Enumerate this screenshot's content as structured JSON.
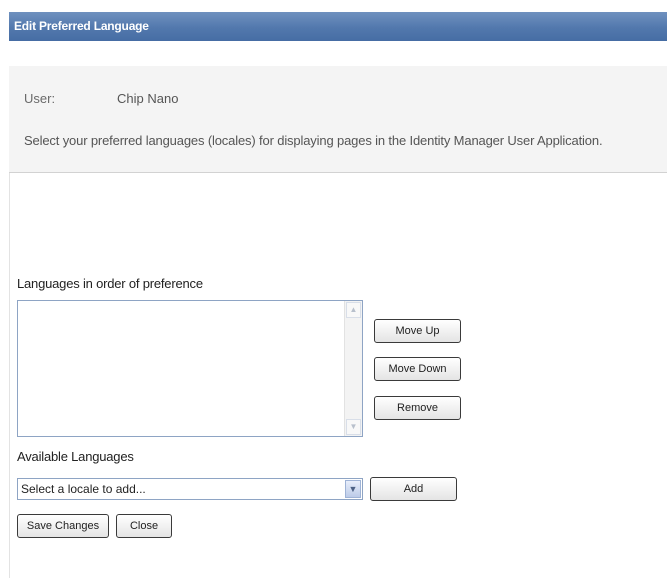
{
  "window": {
    "title": "Edit Preferred Language"
  },
  "info": {
    "user_label": "User:",
    "user_value": "Chip Nano",
    "description": "Select your preferred languages (locales) for displaying pages in the Identity Manager User Application."
  },
  "preferences": {
    "heading": "Languages in order of preference",
    "items": [],
    "move_up_label": "Move Up",
    "move_down_label": "Move Down",
    "remove_label": "Remove"
  },
  "available": {
    "heading": "Available Languages",
    "selected": "Select a locale to add...",
    "add_label": "Add"
  },
  "footer": {
    "save_label": "Save Changes",
    "close_label": "Close"
  },
  "colors": {
    "titlebar": "#5278ad",
    "info_background": "#f4f4f4",
    "field_border": "#8ea4c4"
  },
  "icons": {
    "scroll_up": "scroll-up-icon",
    "scroll_down": "scroll-down-icon",
    "dropdown": "chevron-down-icon"
  }
}
